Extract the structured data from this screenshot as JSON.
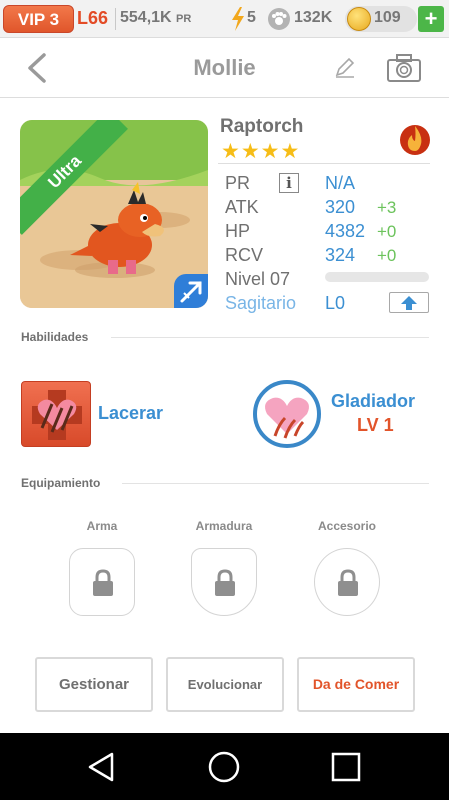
{
  "status_bar": {
    "vip": "VIP 3",
    "level": "L66",
    "power_value": "554,1K",
    "power_unit": "PR",
    "energy": "5",
    "food": "132K",
    "coins": "109",
    "plus_label": "+"
  },
  "header": {
    "title": "Mollie"
  },
  "monster": {
    "ribbon": "Ultra",
    "species": "Raptorch",
    "stars": "★★★★",
    "stats": [
      {
        "label": "PR",
        "value": "N/A",
        "bonus": ""
      },
      {
        "label": "ATK",
        "value": "320",
        "bonus": "+3"
      },
      {
        "label": "HP",
        "value": "4382",
        "bonus": "+0"
      },
      {
        "label": "RCV",
        "value": "324",
        "bonus": "+0"
      }
    ],
    "info_glyph": "i",
    "level_label": "Nivel 07",
    "xp_progress": 0,
    "sign": "Sagitario",
    "sign_level": "L0"
  },
  "abilities": {
    "section_label": "Habilidades",
    "skill_name": "Lacerar",
    "passive_name": "Gladiador",
    "passive_level": "LV 1"
  },
  "equipment": {
    "section_label": "Equipamiento",
    "slots": [
      "Arma",
      "Armadura",
      "Accesorio"
    ]
  },
  "buttons": {
    "manage": "Gestionar",
    "evolve": "Evolucionar",
    "feed": "Da de Comer"
  },
  "colors": {
    "accent_blue": "#3b8fd2",
    "accent_orange": "#e2542a",
    "bonus_green": "#6cc35c",
    "star_yellow": "#f6bd17",
    "ribbon_green": "#43b048"
  }
}
